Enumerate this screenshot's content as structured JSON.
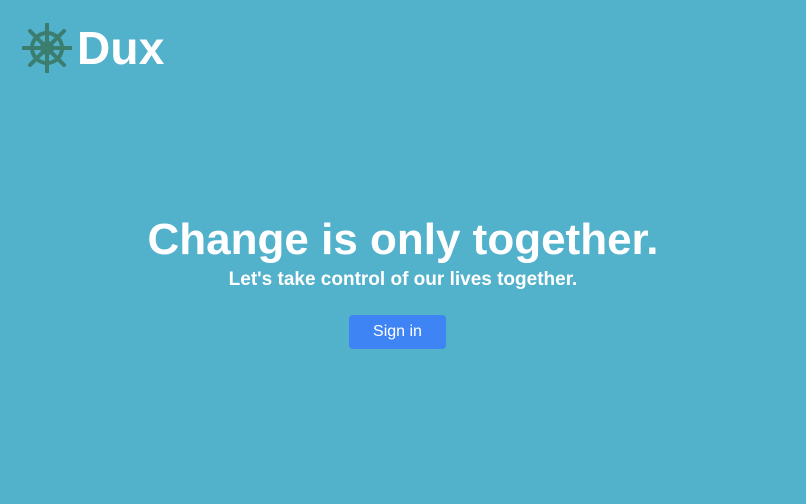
{
  "brand": {
    "name": "Dux",
    "icon": "ship-wheel-icon",
    "icon_color": "#3b7e6f"
  },
  "hero": {
    "headline": "Change is only together.",
    "subheadline": "Let's take control of our lives together."
  },
  "actions": {
    "sign_in_label": "Sign in"
  },
  "colors": {
    "background": "#52b1cb",
    "text": "#ffffff",
    "button": "#3f84f4"
  }
}
